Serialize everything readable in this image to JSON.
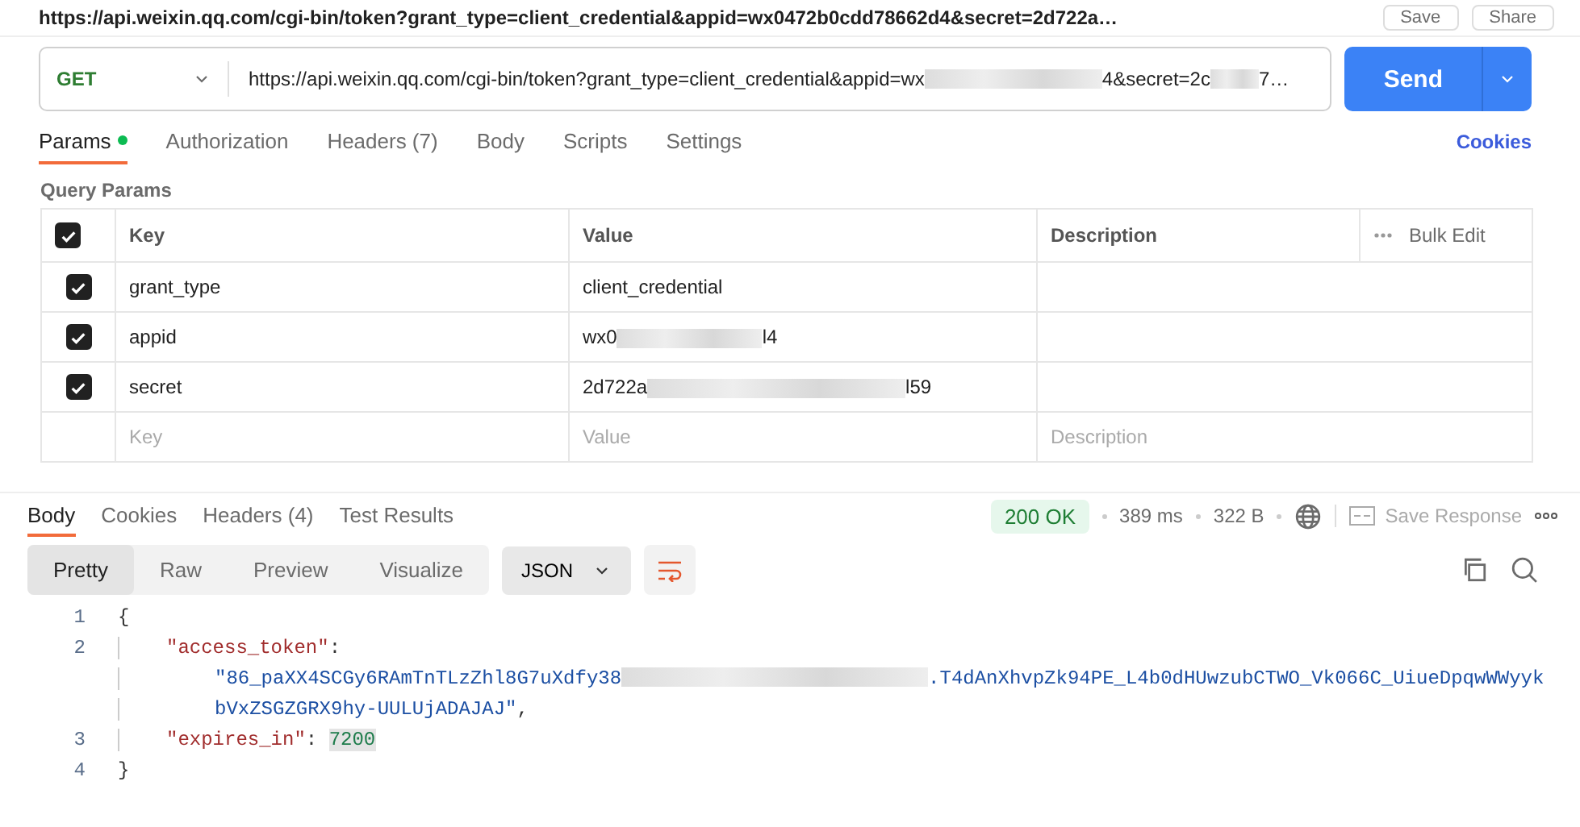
{
  "top_bar": {
    "url": "https://api.weixin.qq.com/cgi-bin/token?grant_type=client_credential&appid=wx0472b0cdd78662d4&secret=2d722a…",
    "buttons": [
      "Save",
      "Share"
    ]
  },
  "request": {
    "method": "GET",
    "url_segments": [
      "https://api.weixin.qq.com/cgi-bin/token?grant_type=client_credential&appid=wx",
      "4&secret=2c",
      "7…"
    ],
    "send": "Send"
  },
  "request_tabs": [
    {
      "label": "Params",
      "selected": true,
      "dot": true
    },
    {
      "label": "Authorization",
      "selected": false,
      "dot": false
    },
    {
      "label": "Headers (7)",
      "selected": false,
      "dot": false
    },
    {
      "label": "Body",
      "selected": false,
      "dot": false
    },
    {
      "label": "Scripts",
      "selected": false,
      "dot": false
    },
    {
      "label": "Settings",
      "selected": false,
      "dot": false
    }
  ],
  "cookies_link": "Cookies",
  "query_params": {
    "title": "Query Params",
    "header_checked": true,
    "columns": [
      "Key",
      "Value",
      "Description"
    ],
    "bulk_edit": "Bulk Edit",
    "rows": [
      {
        "checked": true,
        "key": "grant_type",
        "value_segments": [
          "client_credential"
        ]
      },
      {
        "checked": true,
        "key": "appid",
        "value_segments": [
          "wx0",
          "l4"
        ]
      },
      {
        "checked": true,
        "key": "secret",
        "value_segments": [
          "2d722a",
          "l59"
        ]
      }
    ],
    "placeholder_row": {
      "key": "Key",
      "value": "Value",
      "description": "Description"
    }
  },
  "response_tabs": [
    {
      "label": "Body",
      "selected": true
    },
    {
      "label": "Cookies",
      "selected": false
    },
    {
      "label": "Headers (4)",
      "selected": false
    },
    {
      "label": "Test Results",
      "selected": false
    }
  ],
  "response_meta": {
    "status": "200 OK",
    "time": "389 ms",
    "size": "322 B",
    "save_response": "Save Response"
  },
  "view_modes": [
    {
      "label": "Pretty",
      "selected": true
    },
    {
      "label": "Raw",
      "selected": false
    },
    {
      "label": "Preview",
      "selected": false
    },
    {
      "label": "Visualize",
      "selected": false
    }
  ],
  "format": "JSON",
  "code_lines": [
    {
      "number": "1",
      "tokens": [
        {
          "kind": "punct",
          "text": "{"
        }
      ],
      "children": [
        {
          "number": "2",
          "tokens": [
            {
              "kind": "key",
              "text": "\"access_token\""
            },
            {
              "kind": "punct",
              "text": ":"
            }
          ],
          "children": [
            {
              "tokens": [
                {
                  "kind": "string",
                  "text": "\"86_paXX4SCGy6RAmTnTLzZhl8G7uXdfy38"
                },
                {
                  "kind": "redacted"
                },
                {
                  "kind": "string",
                  "text": ".T4dAnXhvpZk94PE_L4b0dHUwzubCTWO_Vk066C_UiueDpqwWWyyk"
                }
              ]
            },
            {
              "tokens": [
                {
                  "kind": "string",
                  "text": "bVxZSGZGRX9hy-UULUjADAJAJ\""
                },
                {
                  "kind": "punct",
                  "text": ","
                }
              ]
            }
          ]
        },
        {
          "number": "3",
          "tokens": [
            {
              "kind": "key",
              "text": "\"expires_in\""
            },
            {
              "kind": "punct",
              "text": ": "
            },
            {
              "kind": "number",
              "text": "7200"
            }
          ]
        }
      ]
    },
    {
      "number": "4",
      "tokens": [
        {
          "kind": "punct",
          "text": "}"
        }
      ]
    }
  ]
}
